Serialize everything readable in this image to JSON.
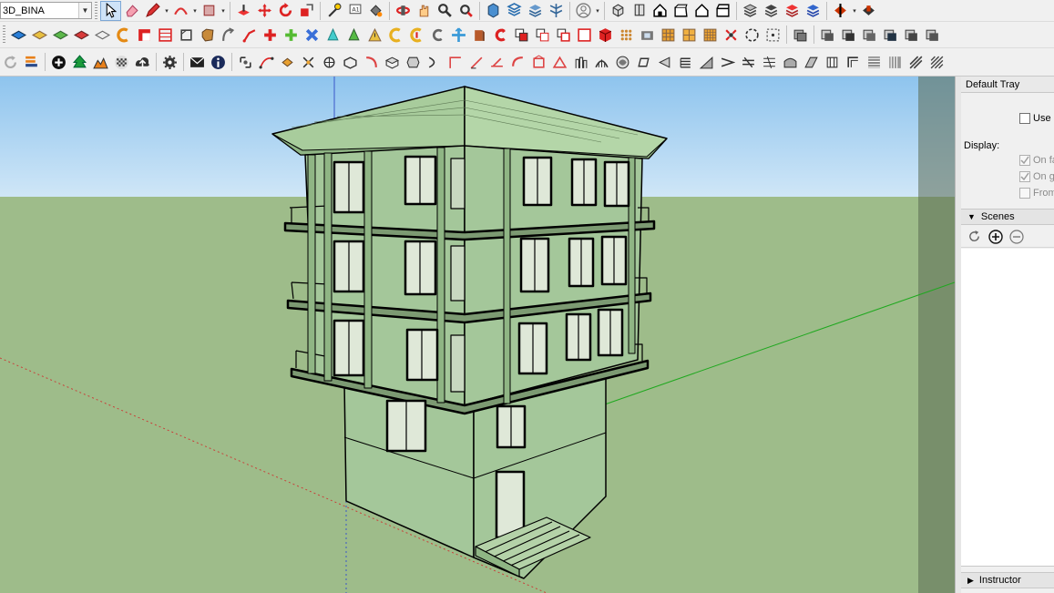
{
  "toolbar": {
    "layer_value": "3D_BINA",
    "row1_icons": [
      "select-arrow-icon",
      "eraser-icon",
      "pencil-line-icon",
      "arc-icon",
      "rectangle-icon",
      "push-pull-icon",
      "move-icon",
      "rotate-icon",
      "scale-icon",
      "offset-icon",
      "tape-measure-icon",
      "text-icon",
      "paint-bucket-icon",
      "orbit-icon",
      "pan-icon",
      "zoom-icon",
      "zoom-extents-icon",
      "warehouse-icon",
      "extension-icon",
      "layers-icon",
      "user-account-icon",
      "component-icon",
      "top-view-icon",
      "front-view-icon",
      "right-view-icon",
      "back-view-icon",
      "left-view-icon",
      "xray-icon",
      "wireframe-icon",
      "hidden-line-icon",
      "shaded-icon",
      "textured-icon",
      "style-icon",
      "section-icon"
    ],
    "row2_icons": [
      "sandbox-icon",
      "smoove-icon",
      "stamp-icon",
      "drape-icon",
      "add-detail-icon",
      "flip-edge-icon",
      "follow-me-icon",
      "intersect-icon",
      "outer-shell-icon",
      "union-icon",
      "subtract-icon",
      "trim-icon",
      "split-icon",
      "solid-tools-icon",
      "curve-icon",
      "axes-icon",
      "position-camera-icon",
      "walk-icon",
      "look-around-icon",
      "section-plane-icon",
      "dimensions-icon",
      "protractor-icon",
      "3d-text-icon",
      "paint-icon",
      "grid-icon"
    ],
    "row3_icons": [
      "refresh-icon",
      "import-icon",
      "add-circle-icon",
      "tree-icon",
      "terrain-icon",
      "texture-icon",
      "upload-icon",
      "settings-icon",
      "mail-icon",
      "info-icon",
      "tool-icon",
      "wave-icon"
    ]
  },
  "tray": {
    "title": "Default Tray",
    "use_label": "Use s",
    "display_label": "Display:",
    "display_options": [
      {
        "label": "On fa",
        "checked": true
      },
      {
        "label": "On g",
        "checked": true
      },
      {
        "label": "From",
        "checked": false
      }
    ],
    "scenes_label": "Scenes",
    "instructor_label": "Instructor"
  },
  "viewport": {
    "sky_color": "#9fccf0",
    "ground_color": "#9ebc8a",
    "model_color": "#a4c79a",
    "axis_red": "#c8413a",
    "axis_green": "#1fa81f",
    "axis_blue": "#3a56c8"
  }
}
